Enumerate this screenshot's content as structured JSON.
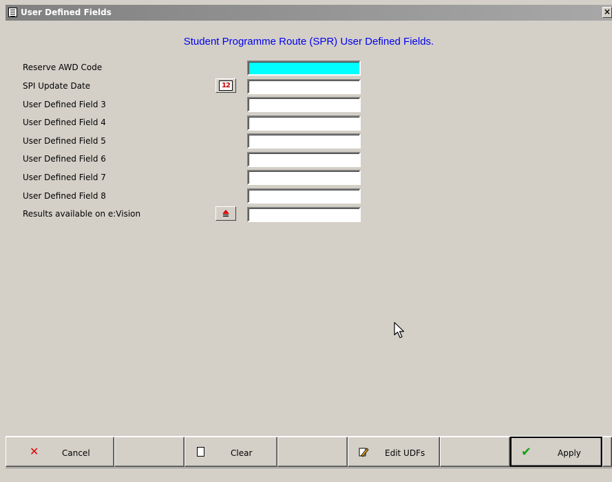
{
  "window": {
    "title": "User Defined Fields",
    "close_glyph": "×"
  },
  "form": {
    "heading": "Student Programme Route (SPR) User Defined Fields.",
    "fields": [
      {
        "label": "Reserve AWD Code",
        "value": ""
      },
      {
        "label": "SPI Update Date",
        "value": ""
      },
      {
        "label": "User Defined Field 3",
        "value": ""
      },
      {
        "label": "User Defined Field 4",
        "value": ""
      },
      {
        "label": "User Defined Field 5",
        "value": ""
      },
      {
        "label": "User Defined Field 6",
        "value": ""
      },
      {
        "label": "User Defined Field 7",
        "value": ""
      },
      {
        "label": "User Defined Field 8",
        "value": ""
      },
      {
        "label": "Results available on e:Vision",
        "value": ""
      }
    ],
    "calendar_icon_text": "12"
  },
  "toolbar": {
    "cancel_label": "Cancel",
    "clear_label": "Clear",
    "edit_udfs_label": "Edit UDFs",
    "apply_label": "Apply"
  },
  "icons": {
    "title": "form-icon",
    "calendar": "calendar-icon",
    "lookup": "lookup-up-icon",
    "cancel": "x-icon",
    "clear": "document-icon",
    "edit": "pencil-icon",
    "apply": "checkmark-icon"
  },
  "colors": {
    "highlight_field": "#00ffff",
    "heading": "#0000ee",
    "background": "#d4d0c8"
  }
}
